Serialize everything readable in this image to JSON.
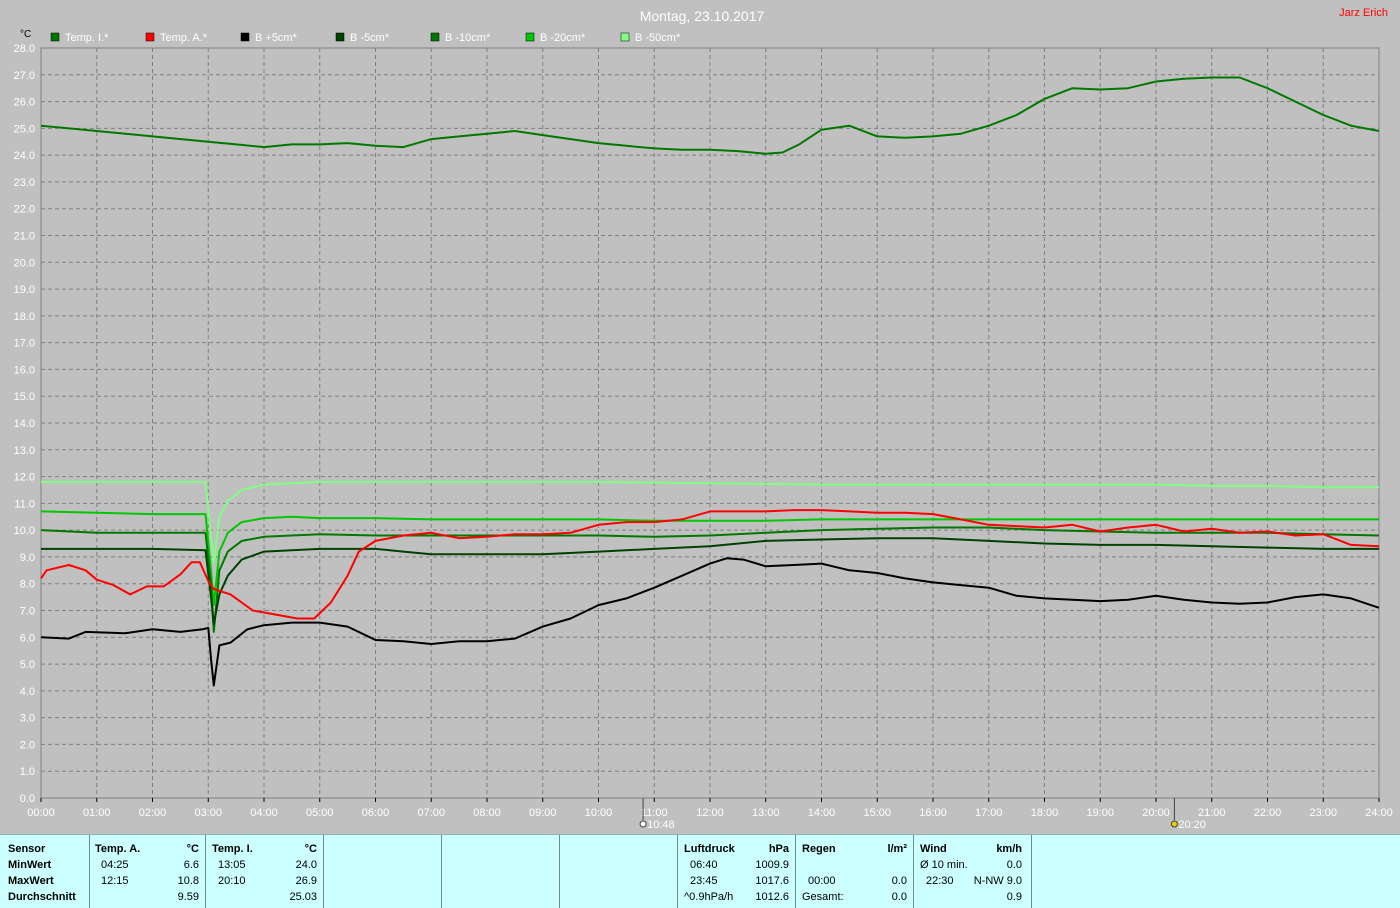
{
  "header": {
    "date_title": "Montag, 23.10.2017",
    "author": "Jarz Erich"
  },
  "chart_data": {
    "type": "line",
    "ylabel": "°C",
    "ylim": [
      0,
      28
    ],
    "xlim": [
      0,
      24
    ],
    "yticks": [
      "0.0",
      "1.0",
      "2.0",
      "3.0",
      "4.0",
      "5.0",
      "6.0",
      "7.0",
      "8.0",
      "9.0",
      "10.0",
      "11.0",
      "12.0",
      "13.0",
      "14.0",
      "15.0",
      "16.0",
      "17.0",
      "18.0",
      "19.0",
      "20.0",
      "21.0",
      "22.0",
      "23.0",
      "24.0",
      "25.0",
      "26.0",
      "27.0",
      "28.0"
    ],
    "xticks": [
      "00:00",
      "01:00",
      "02:00",
      "03:00",
      "04:00",
      "05:00",
      "06:00",
      "07:00",
      "08:00",
      "09:00",
      "10:00",
      "11:00",
      "12:00",
      "13:00",
      "14:00",
      "15:00",
      "16:00",
      "17:00",
      "18:00",
      "19:00",
      "20:00",
      "21:00",
      "22:00",
      "23:00",
      "24:00"
    ],
    "grid": true,
    "legend_position": "top",
    "markers": [
      {
        "label": "10:48",
        "x": 10.8,
        "icon": "sunrise-icon"
      },
      {
        "label": "20:20",
        "x": 20.33,
        "icon": "sunset-icon"
      }
    ],
    "series": [
      {
        "name": "Temp. I.*",
        "color": "#007800",
        "points": [
          [
            0,
            25.1
          ],
          [
            1,
            24.9
          ],
          [
            2,
            24.7
          ],
          [
            3,
            24.5
          ],
          [
            3.5,
            24.4
          ],
          [
            4,
            24.3
          ],
          [
            4.5,
            24.4
          ],
          [
            5,
            24.4
          ],
          [
            5.5,
            24.45
          ],
          [
            6,
            24.35
          ],
          [
            6.5,
            24.3
          ],
          [
            7,
            24.6
          ],
          [
            7.5,
            24.7
          ],
          [
            8,
            24.8
          ],
          [
            8.5,
            24.9
          ],
          [
            9,
            24.75
          ],
          [
            9.5,
            24.6
          ],
          [
            10,
            24.45
          ],
          [
            10.5,
            24.35
          ],
          [
            11,
            24.25
          ],
          [
            11.5,
            24.2
          ],
          [
            12,
            24.2
          ],
          [
            12.5,
            24.15
          ],
          [
            13,
            24.05
          ],
          [
            13.3,
            24.1
          ],
          [
            13.6,
            24.4
          ],
          [
            14,
            24.95
          ],
          [
            14.5,
            25.1
          ],
          [
            15,
            24.7
          ],
          [
            15.5,
            24.65
          ],
          [
            16,
            24.7
          ],
          [
            16.5,
            24.8
          ],
          [
            17,
            25.1
          ],
          [
            17.5,
            25.5
          ],
          [
            18,
            26.1
          ],
          [
            18.5,
            26.5
          ],
          [
            19,
            26.45
          ],
          [
            19.5,
            26.5
          ],
          [
            20,
            26.75
          ],
          [
            20.5,
            26.85
          ],
          [
            21,
            26.9
          ],
          [
            21.5,
            26.9
          ],
          [
            22,
            26.5
          ],
          [
            22.5,
            26.0
          ],
          [
            23,
            25.5
          ],
          [
            23.5,
            25.1
          ],
          [
            24,
            24.9
          ]
        ]
      },
      {
        "name": "Temp. A.*",
        "color": "#ff0000",
        "points": [
          [
            0,
            8.2
          ],
          [
            0.1,
            8.5
          ],
          [
            0.5,
            8.7
          ],
          [
            0.8,
            8.5
          ],
          [
            1,
            8.15
          ],
          [
            1.3,
            7.95
          ],
          [
            1.6,
            7.6
          ],
          [
            1.9,
            7.9
          ],
          [
            2.2,
            7.9
          ],
          [
            2.5,
            8.35
          ],
          [
            2.7,
            8.8
          ],
          [
            2.85,
            8.8
          ],
          [
            3,
            8.1
          ],
          [
            3.1,
            7.8
          ],
          [
            3.4,
            7.6
          ],
          [
            3.8,
            7.0
          ],
          [
            4.2,
            6.85
          ],
          [
            4.6,
            6.7
          ],
          [
            4.9,
            6.7
          ],
          [
            5.2,
            7.3
          ],
          [
            5.5,
            8.3
          ],
          [
            5.7,
            9.2
          ],
          [
            6,
            9.6
          ],
          [
            6.5,
            9.8
          ],
          [
            7,
            9.9
          ],
          [
            7.5,
            9.7
          ],
          [
            8,
            9.75
          ],
          [
            8.5,
            9.85
          ],
          [
            9,
            9.85
          ],
          [
            9.5,
            9.9
          ],
          [
            10,
            10.2
          ],
          [
            10.5,
            10.3
          ],
          [
            11,
            10.3
          ],
          [
            11.5,
            10.4
          ],
          [
            12,
            10.7
          ],
          [
            12.5,
            10.7
          ],
          [
            13,
            10.7
          ],
          [
            13.5,
            10.75
          ],
          [
            14,
            10.75
          ],
          [
            14.5,
            10.7
          ],
          [
            15,
            10.65
          ],
          [
            15.5,
            10.65
          ],
          [
            16,
            10.6
          ],
          [
            16.5,
            10.4
          ],
          [
            17,
            10.2
          ],
          [
            17.5,
            10.15
          ],
          [
            18,
            10.1
          ],
          [
            18.5,
            10.2
          ],
          [
            19,
            9.95
          ],
          [
            19.5,
            10.1
          ],
          [
            20,
            10.2
          ],
          [
            20.5,
            9.95
          ],
          [
            21,
            10.05
          ],
          [
            21.5,
            9.9
          ],
          [
            22,
            9.95
          ],
          [
            22.5,
            9.8
          ],
          [
            23,
            9.85
          ],
          [
            23.5,
            9.45
          ],
          [
            24,
            9.4
          ]
        ]
      },
      {
        "name": "B +5cm*",
        "color": "#000000",
        "points": [
          [
            0,
            6.0
          ],
          [
            0.5,
            5.95
          ],
          [
            0.8,
            6.2
          ],
          [
            1.5,
            6.15
          ],
          [
            2,
            6.3
          ],
          [
            2.5,
            6.2
          ],
          [
            2.9,
            6.3
          ],
          [
            3.0,
            6.35
          ],
          [
            3.05,
            5.2
          ],
          [
            3.1,
            4.2
          ],
          [
            3.2,
            5.7
          ],
          [
            3.4,
            5.8
          ],
          [
            3.7,
            6.3
          ],
          [
            4,
            6.45
          ],
          [
            4.5,
            6.55
          ],
          [
            5,
            6.55
          ],
          [
            5.5,
            6.4
          ],
          [
            6,
            5.9
          ],
          [
            6.5,
            5.85
          ],
          [
            7,
            5.75
          ],
          [
            7.5,
            5.85
          ],
          [
            8,
            5.85
          ],
          [
            8.5,
            5.95
          ],
          [
            9,
            6.4
          ],
          [
            9.5,
            6.7
          ],
          [
            10,
            7.2
          ],
          [
            10.5,
            7.45
          ],
          [
            11,
            7.85
          ],
          [
            11.5,
            8.3
          ],
          [
            12,
            8.75
          ],
          [
            12.3,
            8.95
          ],
          [
            12.6,
            8.9
          ],
          [
            13,
            8.65
          ],
          [
            13.5,
            8.7
          ],
          [
            14,
            8.75
          ],
          [
            14.5,
            8.5
          ],
          [
            15,
            8.4
          ],
          [
            15.5,
            8.2
          ],
          [
            16,
            8.05
          ],
          [
            16.5,
            7.95
          ],
          [
            17,
            7.85
          ],
          [
            17.5,
            7.55
          ],
          [
            18,
            7.45
          ],
          [
            18.5,
            7.4
          ],
          [
            19,
            7.35
          ],
          [
            19.5,
            7.4
          ],
          [
            20,
            7.55
          ],
          [
            20.5,
            7.4
          ],
          [
            21,
            7.3
          ],
          [
            21.5,
            7.25
          ],
          [
            22,
            7.3
          ],
          [
            22.5,
            7.5
          ],
          [
            23,
            7.6
          ],
          [
            23.5,
            7.45
          ],
          [
            24,
            7.1
          ]
        ]
      },
      {
        "name": "B -5cm*",
        "color": "#004000",
        "points": [
          [
            0,
            9.3
          ],
          [
            2,
            9.3
          ],
          [
            2.95,
            9.25
          ],
          [
            3.05,
            7.5
          ],
          [
            3.1,
            6.5
          ],
          [
            3.2,
            7.6
          ],
          [
            3.35,
            8.3
          ],
          [
            3.6,
            8.9
          ],
          [
            4,
            9.2
          ],
          [
            5,
            9.3
          ],
          [
            6,
            9.3
          ],
          [
            6.5,
            9.2
          ],
          [
            7,
            9.1
          ],
          [
            8,
            9.1
          ],
          [
            9,
            9.1
          ],
          [
            10,
            9.2
          ],
          [
            11,
            9.3
          ],
          [
            12,
            9.4
          ],
          [
            13,
            9.6
          ],
          [
            14,
            9.65
          ],
          [
            15,
            9.7
          ],
          [
            16,
            9.7
          ],
          [
            17,
            9.6
          ],
          [
            18,
            9.5
          ],
          [
            19,
            9.45
          ],
          [
            20,
            9.45
          ],
          [
            21,
            9.4
          ],
          [
            22,
            9.35
          ],
          [
            23,
            9.3
          ],
          [
            24,
            9.3
          ]
        ]
      },
      {
        "name": "B -10cm*",
        "color": "#007800",
        "points": [
          [
            0,
            10.0
          ],
          [
            1,
            9.9
          ],
          [
            2,
            9.9
          ],
          [
            2.95,
            9.9
          ],
          [
            3.05,
            8.0
          ],
          [
            3.1,
            6.2
          ],
          [
            3.2,
            8.5
          ],
          [
            3.35,
            9.2
          ],
          [
            3.6,
            9.6
          ],
          [
            4,
            9.75
          ],
          [
            5,
            9.85
          ],
          [
            6,
            9.8
          ],
          [
            7,
            9.8
          ],
          [
            8,
            9.8
          ],
          [
            9,
            9.8
          ],
          [
            10,
            9.8
          ],
          [
            11,
            9.75
          ],
          [
            12,
            9.8
          ],
          [
            13,
            9.9
          ],
          [
            14,
            10.0
          ],
          [
            15,
            10.05
          ],
          [
            16,
            10.1
          ],
          [
            17,
            10.1
          ],
          [
            18,
            10.0
          ],
          [
            19,
            9.95
          ],
          [
            20,
            9.9
          ],
          [
            21,
            9.9
          ],
          [
            22,
            9.9
          ],
          [
            23,
            9.85
          ],
          [
            24,
            9.8
          ]
        ]
      },
      {
        "name": "B -20cm*",
        "color": "#00c800",
        "points": [
          [
            0,
            10.7
          ],
          [
            1,
            10.65
          ],
          [
            2,
            10.6
          ],
          [
            2.95,
            10.6
          ],
          [
            3.05,
            8.5
          ],
          [
            3.1,
            7.2
          ],
          [
            3.2,
            9.2
          ],
          [
            3.35,
            9.9
          ],
          [
            3.6,
            10.3
          ],
          [
            4,
            10.45
          ],
          [
            4.5,
            10.5
          ],
          [
            5,
            10.45
          ],
          [
            6,
            10.45
          ],
          [
            7,
            10.4
          ],
          [
            8,
            10.4
          ],
          [
            9,
            10.4
          ],
          [
            10,
            10.4
          ],
          [
            11,
            10.35
          ],
          [
            12,
            10.35
          ],
          [
            13,
            10.35
          ],
          [
            14,
            10.4
          ],
          [
            15,
            10.4
          ],
          [
            16,
            10.4
          ],
          [
            17,
            10.4
          ],
          [
            18,
            10.4
          ],
          [
            19,
            10.4
          ],
          [
            20,
            10.4
          ],
          [
            21,
            10.4
          ],
          [
            22,
            10.4
          ],
          [
            23,
            10.4
          ],
          [
            24,
            10.4
          ]
        ]
      },
      {
        "name": "B -50cm*",
        "color": "#80ff80",
        "points": [
          [
            0,
            11.8
          ],
          [
            1,
            11.8
          ],
          [
            2,
            11.8
          ],
          [
            2.95,
            11.8
          ],
          [
            3.05,
            9.8
          ],
          [
            3.1,
            8.8
          ],
          [
            3.2,
            10.5
          ],
          [
            3.35,
            11.1
          ],
          [
            3.6,
            11.5
          ],
          [
            4,
            11.7
          ],
          [
            4.5,
            11.75
          ],
          [
            5,
            11.8
          ],
          [
            6,
            11.8
          ],
          [
            8,
            11.8
          ],
          [
            10,
            11.8
          ],
          [
            12,
            11.75
          ],
          [
            14,
            11.7
          ],
          [
            16,
            11.7
          ],
          [
            18,
            11.7
          ],
          [
            20,
            11.7
          ],
          [
            21,
            11.65
          ],
          [
            22,
            11.65
          ],
          [
            23,
            11.6
          ],
          [
            24,
            11.6
          ]
        ]
      }
    ]
  },
  "stats": {
    "sensor": {
      "title": "Sensor",
      "rows": [
        "MinWert",
        "MaxWert",
        "Durchschnitt"
      ]
    },
    "temp_a": {
      "title": "Temp. A.",
      "unit": "°C",
      "min_time": "04:25",
      "min_val": "6.6",
      "max_time": "12:15",
      "max_val": "10.8",
      "avg": "9.59"
    },
    "temp_i": {
      "title": "Temp. I.",
      "unit": "°C",
      "min_time": "13:05",
      "min_val": "24.0",
      "max_time": "20:10",
      "max_val": "26.9",
      "avg": "25.03"
    },
    "luftdruck": {
      "title": "Luftdruck",
      "unit": "hPa",
      "min_time": "06:40",
      "min_val": "1009.9",
      "max_time": "23:45",
      "max_val": "1017.6",
      "trend": "^0.9hPa/h",
      "current": "1012.6"
    },
    "regen": {
      "title": "Regen",
      "unit": "l/m²",
      "time": "00:00",
      "val": "0.0",
      "total_label": "Gesamt:",
      "total": "0.0"
    },
    "wind": {
      "title": "Wind",
      "unit": "km/h",
      "avg_label": "Ø 10 min.",
      "avg_val": "0.0",
      "max_time": "22:30",
      "max_val": "N-NW 9.0",
      "mean": "0.9"
    }
  }
}
